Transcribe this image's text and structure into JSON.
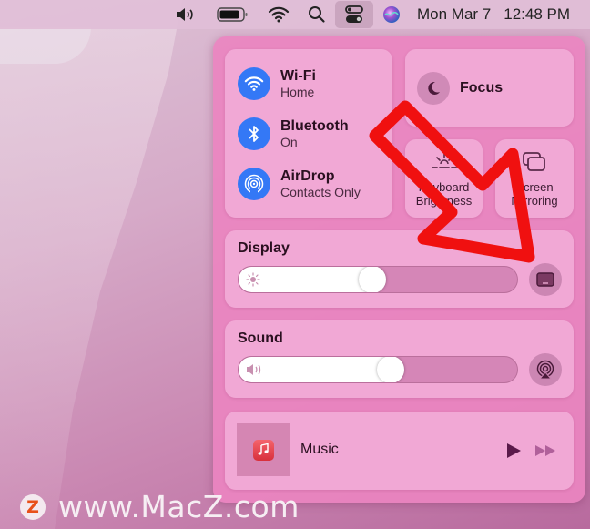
{
  "menubar": {
    "icons": [
      "volume-icon",
      "battery-icon",
      "wifi-icon",
      "search-icon",
      "control-center-icon",
      "siri-icon"
    ],
    "date": "Mon Mar 7",
    "time": "12:48 PM"
  },
  "control_center": {
    "network": [
      {
        "title": "Wi-Fi",
        "status": "Home",
        "icon": "wifi-icon"
      },
      {
        "title": "Bluetooth",
        "status": "On",
        "icon": "bluetooth-icon"
      },
      {
        "title": "AirDrop",
        "status": "Contacts Only",
        "icon": "airdrop-icon"
      }
    ],
    "focus": {
      "label": "Focus",
      "icon": "moon-icon"
    },
    "keyboard_brightness": {
      "line1": "Keyboard",
      "line2": "Brightness",
      "icon": "keyboard-brightness-icon"
    },
    "screen_mirroring": {
      "line1": "Screen",
      "line2": "Mirroring",
      "icon": "screen-mirroring-icon"
    },
    "display": {
      "label": "Display",
      "brightness_percent": 48,
      "icon": "sun-icon",
      "button_icon": "display-icon"
    },
    "sound": {
      "label": "Sound",
      "volume_percent": 55,
      "icon": "speaker-icon",
      "button_icon": "airplay-audio-icon"
    },
    "now_playing": {
      "app": "Music",
      "icon": "music-note-icon",
      "controls": [
        "play-icon",
        "fast-forward-icon"
      ]
    }
  },
  "annotation": {
    "color": "#f01010",
    "shape": "arrow"
  },
  "watermark": {
    "logo": "Z",
    "text": "www.MacZ.com"
  }
}
